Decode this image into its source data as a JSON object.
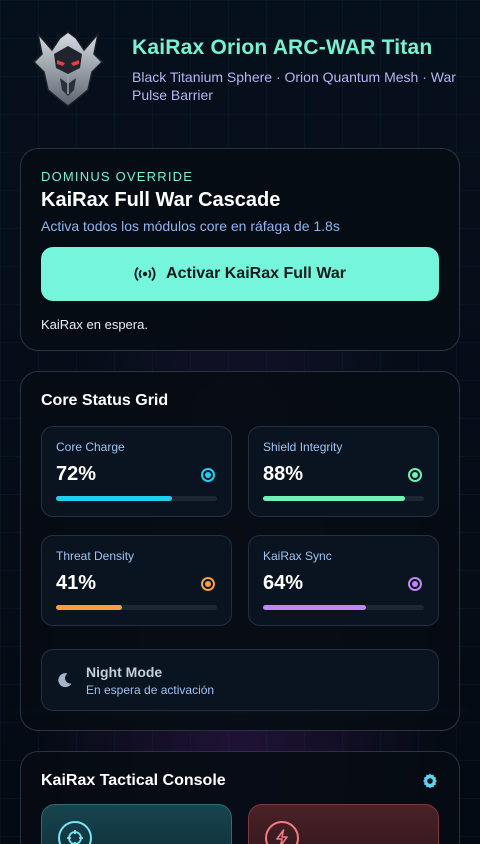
{
  "header": {
    "title": "KaiRax Orion ARC-WAR Titan",
    "subtitle": "Black Titanium Sphere · Orion Quantum Mesh · War Pulse Barrier",
    "logo_icon": "demon-helmet-logo"
  },
  "override": {
    "kicker": "DOMINUS OVERRIDE",
    "title": "KaiRax Full War Cascade",
    "description": "Activa todos los módulos core en ráfaga de 1.8s",
    "button_label": "Activar KaiRax Full War",
    "button_icon": "broadcast-icon",
    "status": "KaiRax en espera."
  },
  "core_status": {
    "title": "Core Status Grid",
    "tiles": [
      {
        "label": "Core Charge",
        "value": "72%",
        "level": 0.72,
        "color": "#20cfee"
      },
      {
        "label": "Shield Integrity",
        "value": "88%",
        "level": 0.88,
        "color": "#6ff0b4"
      },
      {
        "label": "Threat Density",
        "value": "41%",
        "level": 0.41,
        "color": "#f5a13c"
      },
      {
        "label": "KaiRax Sync",
        "value": "64%",
        "level": 0.64,
        "color": "#c186f5"
      }
    ],
    "night_mode": {
      "label": "Night Mode",
      "sublabel": "En espera de activación",
      "icon": "moon-icon"
    }
  },
  "console": {
    "title": "KaiRax Tactical Console",
    "settings_icon": "gear-icon",
    "tiles": [
      {
        "icon": "crosshair-icon",
        "color": "#7be3f5"
      },
      {
        "icon": "lightning-icon",
        "color": "#f47a82"
      }
    ]
  },
  "colors": {
    "accent": "#77f2d2",
    "button": "#74f5dc",
    "subtitle": "#b7b4f2"
  }
}
